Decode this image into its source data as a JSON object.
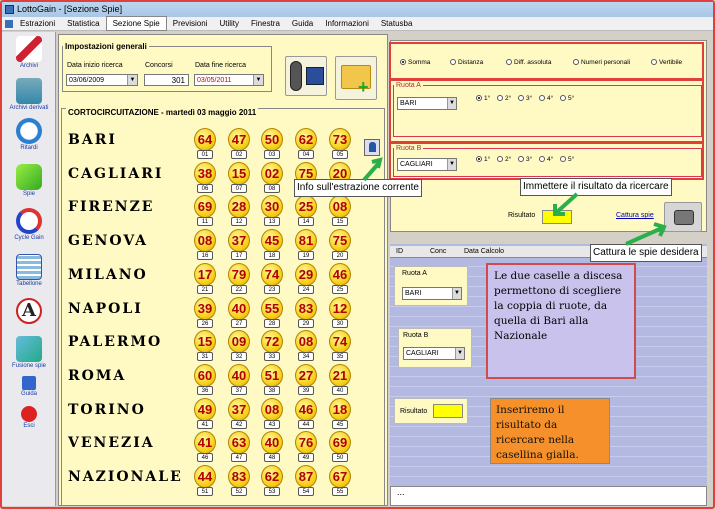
{
  "window": {
    "title": "LottoGain - [Sezione Spie]"
  },
  "menu": [
    "Estrazioni",
    "Statistica",
    "Sezione Spie",
    "Previsioni",
    "Utility",
    "Finestra",
    "Guida",
    "Informazioni",
    "Statusba"
  ],
  "toolbar": [
    "Archivi",
    "Archivi derivati",
    "Ritardi",
    "Spie",
    "Cycle Gain",
    "Tabellone",
    "",
    "Fusione spie",
    "Guida",
    "Esci"
  ],
  "settings": {
    "legend": "Impostazioni generali",
    "start_label": "Data inizio ricerca",
    "start_value": "03/06/2009",
    "count_label": "Concorsi",
    "count_value": "301",
    "end_label": "Data fine ricerca",
    "end_value": "03/05/2011"
  },
  "draw": {
    "title": "CORTOCIRCUITAZIONE - martedì 03 maggio 2011",
    "rows": [
      {
        "city": "BARI",
        "nums": [
          "64",
          "47",
          "50",
          "62",
          "73"
        ]
      },
      {
        "city": "CAGLIARI",
        "nums": [
          "38",
          "15",
          "02",
          "75",
          "20"
        ]
      },
      {
        "city": "FIRENZE",
        "nums": [
          "69",
          "28",
          "30",
          "25",
          "08"
        ]
      },
      {
        "city": "GENOVA",
        "nums": [
          "08",
          "37",
          "45",
          "81",
          "75"
        ]
      },
      {
        "city": "MILANO",
        "nums": [
          "17",
          "79",
          "74",
          "29",
          "46"
        ]
      },
      {
        "city": "NAPOLI",
        "nums": [
          "39",
          "40",
          "55",
          "83",
          "12"
        ]
      },
      {
        "city": "PALERMO",
        "nums": [
          "15",
          "09",
          "72",
          "08",
          "74"
        ]
      },
      {
        "city": "ROMA",
        "nums": [
          "60",
          "40",
          "51",
          "27",
          "21"
        ]
      },
      {
        "city": "TORINO",
        "nums": [
          "49",
          "37",
          "08",
          "46",
          "18"
        ]
      },
      {
        "city": "VENEZIA",
        "nums": [
          "41",
          "63",
          "40",
          "76",
          "69"
        ]
      },
      {
        "city": "NAZIONALE",
        "nums": [
          "44",
          "83",
          "62",
          "87",
          "67"
        ]
      }
    ]
  },
  "mode": {
    "options": [
      "Somma",
      "Distanza",
      "Diff. assoluta",
      "Numeri personali",
      "Vertibile"
    ],
    "selected": "Somma"
  },
  "ruota_a": {
    "legend": "Ruota A",
    "value": "BARI",
    "positions": [
      "1°",
      "2°",
      "3°",
      "4°",
      "5°"
    ]
  },
  "ruota_b": {
    "legend": "Ruota B",
    "value": "CAGLIARI",
    "positions": [
      "1°",
      "2°",
      "3°",
      "4°",
      "5°"
    ]
  },
  "result": {
    "label": "Risultato",
    "cattura": "Cattura spie"
  },
  "grid": {
    "headers": [
      "ID",
      "Conc",
      "Data Calcolo"
    ]
  },
  "lower": {
    "ruota_a": "Ruota A",
    "ruota_a_value": "BARI",
    "ruota_b": "Ruota B",
    "ruota_b_value": "CAGLIARI",
    "risultato": "Risultato"
  },
  "callouts": {
    "info": "Info sull'estrazione corrente",
    "immettere": "Immettere il risultato da ricercare",
    "cattura": "Cattura le spie desidera",
    "note1": "Le due caselle a discesa permettono di scegliere la coppia di ruote, da quella di Bari alla Nazionale",
    "note2": "Inseriremo il risultato da ricercare nella casellina gialla."
  },
  "bottom": "...",
  "colors": {
    "panel": "#fff9c4",
    "grid": "#b4b9e2",
    "highlight": "#e0403c",
    "arrow": "#2ab04a",
    "note1_bg": "#c9c2ec",
    "note2_bg": "#f6902a"
  }
}
